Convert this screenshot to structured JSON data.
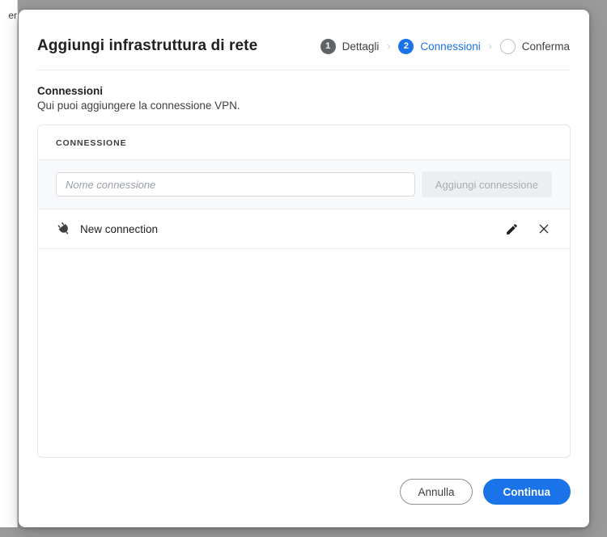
{
  "background": {
    "fragment_text": "er"
  },
  "modal": {
    "title": "Aggiungi infrastruttura di rete",
    "stepper": {
      "separator": "›",
      "steps": [
        {
          "number": "1",
          "label": "Dettagli",
          "state": "done"
        },
        {
          "number": "2",
          "label": "Connessioni",
          "state": "active"
        },
        {
          "number": "",
          "label": "Conferma",
          "state": "todo"
        }
      ]
    },
    "section": {
      "title": "Connessioni",
      "subtitle": "Qui puoi aggiungere la connessione VPN."
    },
    "card": {
      "header": "CONNESSIONE",
      "input": {
        "placeholder": "Nome connessione",
        "value": ""
      },
      "add_button": {
        "label": "Aggiungi connessione",
        "disabled": true
      },
      "connections": [
        {
          "icon": "plug-icon",
          "name": "New connection",
          "edit_icon": "pencil-icon",
          "delete_icon": "close-icon"
        }
      ]
    },
    "footer": {
      "cancel_label": "Annulla",
      "continue_label": "Continua"
    }
  },
  "colors": {
    "accent_blue": "#1a73e8",
    "step_done_gray": "#5f6368",
    "step_todo_border": "#bdc1c6",
    "page_backdrop": "#9a9a9a",
    "card_border": "#e4e6e8",
    "add_row_bg": "#f8f9fa",
    "disabled_btn_bg": "#eceef0",
    "disabled_btn_text": "#a7adb3"
  }
}
